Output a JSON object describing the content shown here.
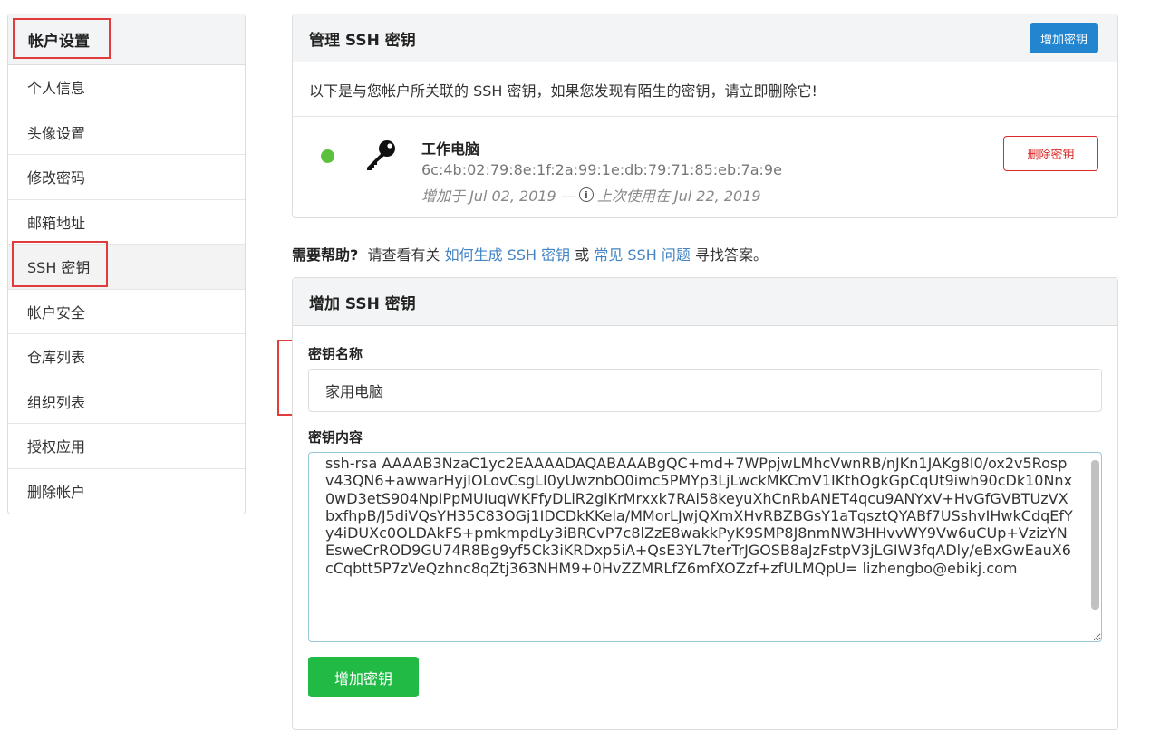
{
  "sidebar": {
    "header": "帐户设置",
    "items": [
      {
        "label": "个人信息"
      },
      {
        "label": "头像设置"
      },
      {
        "label": "修改密码"
      },
      {
        "label": "邮箱地址"
      },
      {
        "label": "SSH 密钥"
      },
      {
        "label": "帐户安全"
      },
      {
        "label": "仓库列表"
      },
      {
        "label": "组织列表"
      },
      {
        "label": "授权应用"
      },
      {
        "label": "删除帐户"
      }
    ]
  },
  "manage": {
    "title": "管理 SSH 密钥",
    "add_button": "增加密钥",
    "intro": "以下是与您帐户所关联的 SSH 密钥，如果您发现有陌生的密钥，请立即删除它!",
    "keys": [
      {
        "status_color": "#5cbf3e",
        "icon": "key-icon",
        "name": "工作电脑",
        "fingerprint": "6c:4b:02:79:8e:1f:2a:99:1e:db:79:71:85:eb:7a:9e",
        "added": "增加于 Jul 02, 2019 —",
        "last_used": "上次使用在 Jul 22, 2019",
        "delete_button": "删除密钥"
      }
    ]
  },
  "help": {
    "prefix": "需要帮助?",
    "text1": "请查看有关",
    "link1": "如何生成 SSH 密钥",
    "text2": "或",
    "link2": "常见 SSH 问题",
    "text3": "寻找答案。"
  },
  "add_form": {
    "title": "增加 SSH 密钥",
    "name_label": "密钥名称",
    "name_value": "家用电脑",
    "content_label": "密钥内容",
    "content_value": "ssh-rsa AAAAB3NzaC1yc2EAAAADAQABAAABgQC+md+7WPpjwLMhcVwnRB/nJKn1JAKg8I0/ox2v5Rospv43QN6+awwarHyjIOLovCsgLI0yUwznbO0imc5PMYp3LjLwckMKCmV1IKthOgkGpCqUt9iwh90cDk10Nnx0wD3etS904NpIPpMUIuqWKFfyDLiR2giKrMrxxk7RAi58keyuXhCnRbANET4qcu9ANYxV+HvGfGVBTUzVXbxfhpB/J5diVQsYH35C83OGj1IDCDkKKela/MMorLJwjQXmXHvRBZBGsY1aTqsztQYABf7USshvIHwkCdqEfYy4iDUXc0OLDAkFS+pmkmpdLy3iBRCvP7c8lZzE8wakkPyK9SMP8J8nmNW3HHvvWY9Vw6uCUp+VzizYNEsweCrROD9GU74R8Bg9yf5Ck3iKRDxp5iA+QsE3YL7terTrJGOSB8aJzFstpV3jLGIW3fqADly/eBxGwEauX6cCqbtt5P7zVeQzhnc8qZtj363NHM9+0HvZZMRLfZ6mfXOZzf+zfULMQpU= lizhengbo@ebikj.com",
    "submit_button": "增加密钥"
  },
  "colors": {
    "highlight_box": "#e03c3c",
    "primary": "#2185d0",
    "danger": "#db2828",
    "success": "#21ba45",
    "link": "#4183c4"
  }
}
